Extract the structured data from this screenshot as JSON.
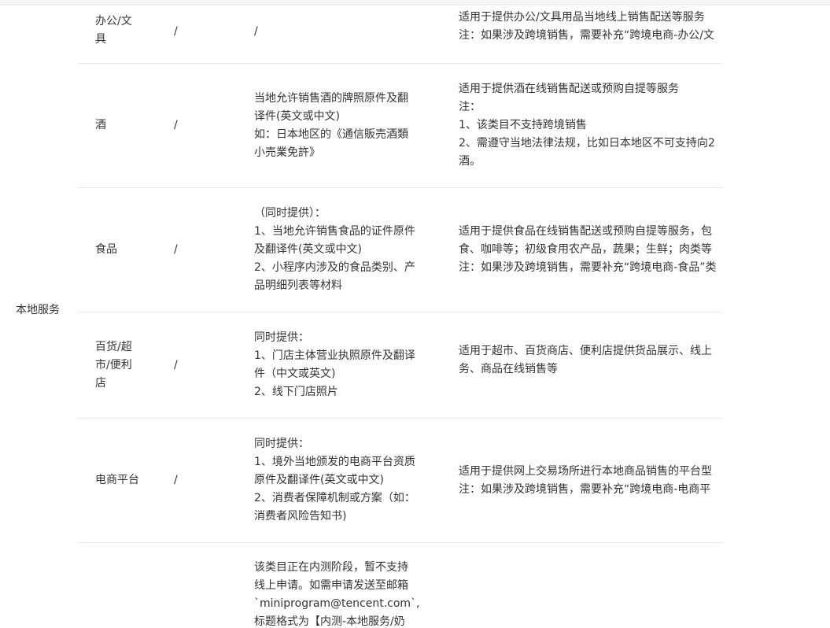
{
  "category": "本地服务",
  "rows": [
    {
      "name": "办公/文\n具",
      "a": "/",
      "b": "/",
      "c": "适用于提供办公/文具用品当地线上销售配送等服务\n注：如果涉及跨境销售，需要补充“跨境电商-办公/文"
    },
    {
      "name": "酒",
      "a": "/",
      "b": "当地允许销售酒的牌照原件及翻\n译件(英文或中文)\n如：日本地区的《通信販売酒類\n小売業免許》",
      "c": "适用于提供酒在线销售配送或预购自提等服务\n注：\n1、该类目不支持跨境销售\n2、需遵守当地法律法规，比如日本地区不可支持向2\n酒。"
    },
    {
      "name": "食品",
      "a": "/",
      "b": "（同时提供）：\n1、当地允许销售食品的证件原件\n及翻译件(英文或中文)\n2、小程序内涉及的食品类别、产\n品明细列表等材料",
      "c": "适用于提供食品在线销售配送或预购自提等服务，包\n食、咖啡等；初级食用农产品，蔬果；生鲜；肉类等\n注：如果涉及跨境销售，需要补充“跨境电商-食品”类"
    },
    {
      "name": "百货/超\n市/便利\n店",
      "a": "/",
      "b": "同时提供：\n1、门店主体营业执照原件及翻译\n件（中文或英文)\n2、线下门店照片",
      "c": "适用于超市、百货商店、便利店提供货品展示、线上\n务、商品在线销售等"
    },
    {
      "name": "电商平台",
      "a": "/",
      "b": "同时提供：\n1、境外当地颁发的电商平台资质\n原件及翻译件(英文或中文)\n2、消费者保障机制或方案（如：\n消费者风险告知书)",
      "c": "适用于提供网上交易场所进行本地商品销售的平台型\n注：如果涉及跨境销售，需要补充“跨境电商-电商平"
    },
    {
      "name": "",
      "a": "",
      "b": "该类目正在内测阶段，暂不支持\n线上申请。如需申请发送至邮箱\n`miniprogram@tencent.com`,\n标题格式为【内测-本地服务/奶",
      "c": ""
    }
  ]
}
